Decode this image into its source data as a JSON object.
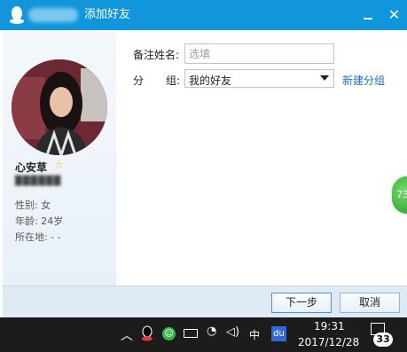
{
  "window": {
    "title": "添加好友",
    "colors": {
      "titlebar": "#1296db",
      "link": "#1a6fc4",
      "star": "#f3b500"
    }
  },
  "profile": {
    "nickname": "心安草",
    "gender": "性别: 女",
    "age": "年龄: 24岁",
    "location": "所在地: - -"
  },
  "form": {
    "remark_label": "备注姓名:",
    "remark_placeholder": "选填",
    "group_label_1": "分",
    "group_label_2": "组:",
    "group_value": "我的好友",
    "new_group_link": "新建分组"
  },
  "buttons": {
    "next": "下一步",
    "cancel": "取消"
  },
  "float_badge": "73",
  "taskbar": {
    "ime": "中",
    "baidu": "du",
    "time": "19:31",
    "date": "2017/12/28",
    "notification_count": "33"
  }
}
